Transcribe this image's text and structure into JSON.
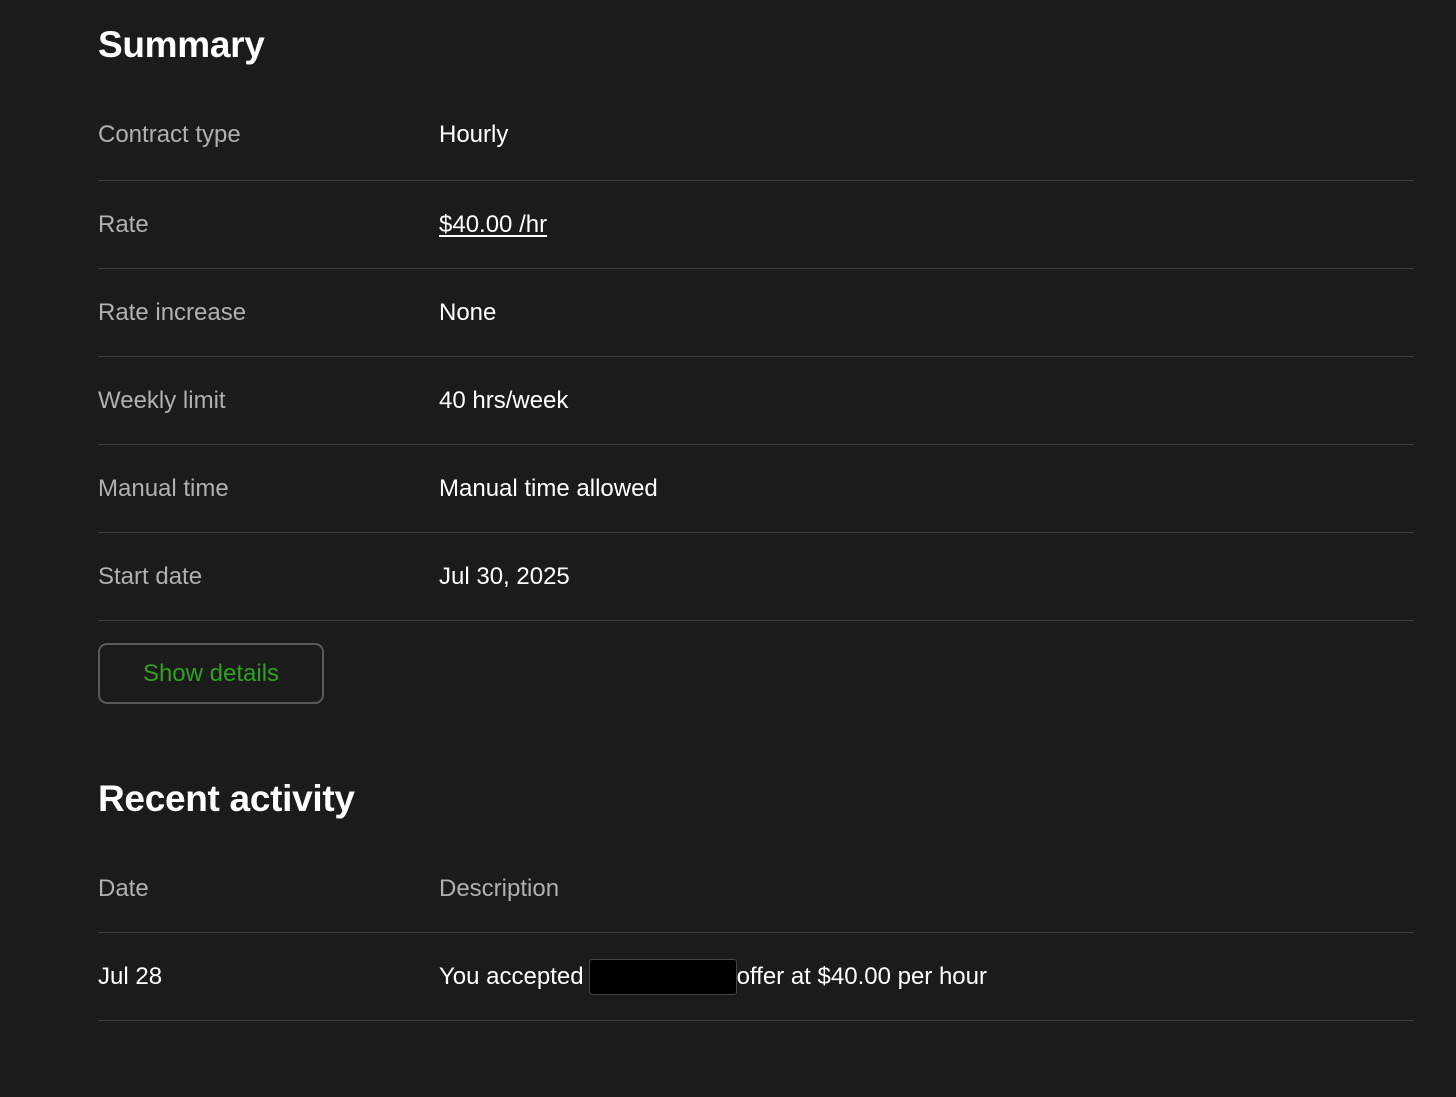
{
  "summary": {
    "title": "Summary",
    "rows": [
      {
        "label": "Contract type",
        "value": "Hourly"
      },
      {
        "label": "Rate",
        "value": "$40.00 /hr"
      },
      {
        "label": "Rate increase",
        "value": "None"
      },
      {
        "label": "Weekly limit",
        "value": "40 hrs/week"
      },
      {
        "label": "Manual time",
        "value": "Manual time allowed"
      },
      {
        "label": "Start date",
        "value": "Jul 30, 2025"
      }
    ],
    "show_details_label": "Show details"
  },
  "activity": {
    "title": "Recent activity",
    "columns": [
      "Date",
      "Description"
    ],
    "rows": [
      {
        "date": "Jul 28",
        "description_prefix": "You accepted",
        "description_suffix": "offer at $40.00 per hour"
      }
    ]
  },
  "colors": {
    "background": "#1b1b1b",
    "accent_green": "#2fa01f",
    "label_gray": "#b0b0b0",
    "divider": "#3d3d3d"
  }
}
